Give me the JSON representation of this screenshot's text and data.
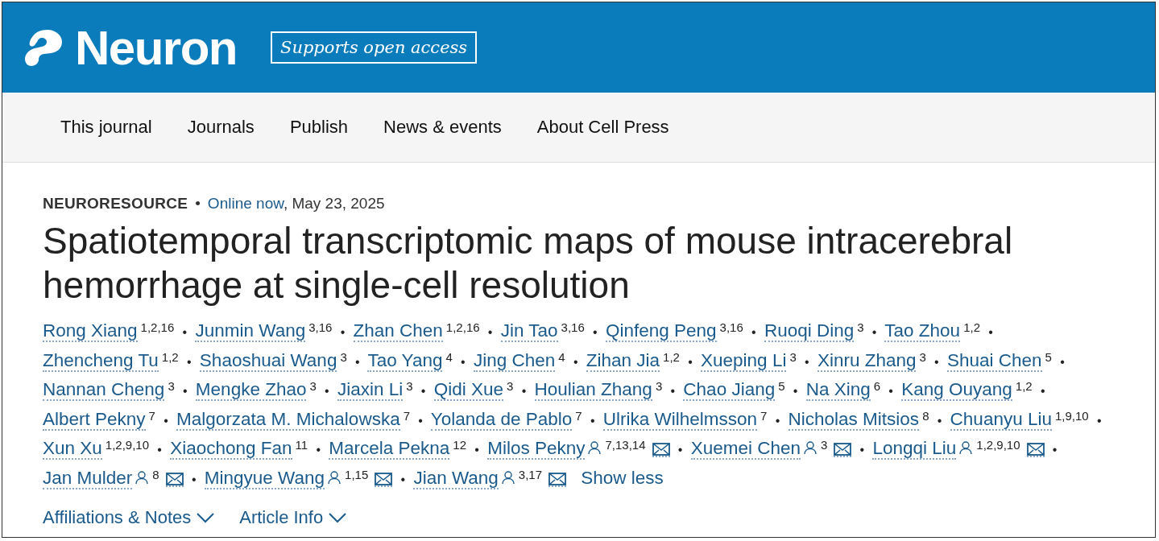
{
  "header": {
    "journal": "Neuron",
    "badge": "Supports open access"
  },
  "nav": {
    "items": [
      "This journal",
      "Journals",
      "Publish",
      "News & events",
      "About Cell Press"
    ]
  },
  "article": {
    "type": "NEURORESOURCE",
    "separator": "•",
    "status": "Online now",
    "date": ", May 23, 2025",
    "title": "Spatiotemporal transcriptomic maps of mouse intracerebral hemorrhage at single-cell resolution",
    "author_separator": "•",
    "authors": [
      {
        "name": "Rong Xiang",
        "affiliations": "1,2,16",
        "corresponding": false
      },
      {
        "name": "Junmin Wang",
        "affiliations": "3,16",
        "corresponding": false
      },
      {
        "name": "Zhan Chen",
        "affiliations": "1,2,16",
        "corresponding": false
      },
      {
        "name": "Jin Tao",
        "affiliations": "3,16",
        "corresponding": false
      },
      {
        "name": "Qinfeng Peng",
        "affiliations": "3,16",
        "corresponding": false
      },
      {
        "name": "Ruoqi Ding",
        "affiliations": "3",
        "corresponding": false
      },
      {
        "name": "Tao Zhou",
        "affiliations": "1,2",
        "corresponding": false
      },
      {
        "name": "Zhencheng Tu",
        "affiliations": "1,2",
        "corresponding": false
      },
      {
        "name": "Shaoshuai Wang",
        "affiliations": "3",
        "corresponding": false
      },
      {
        "name": "Tao Yang",
        "affiliations": "4",
        "corresponding": false
      },
      {
        "name": "Jing Chen",
        "affiliations": "4",
        "corresponding": false
      },
      {
        "name": "Zihan Jia",
        "affiliations": "1,2",
        "corresponding": false
      },
      {
        "name": "Xueping Li",
        "affiliations": "3",
        "corresponding": false
      },
      {
        "name": "Xinru Zhang",
        "affiliations": "3",
        "corresponding": false
      },
      {
        "name": "Shuai Chen",
        "affiliations": "5",
        "corresponding": false
      },
      {
        "name": "Nannan Cheng",
        "affiliations": "3",
        "corresponding": false
      },
      {
        "name": "Mengke Zhao",
        "affiliations": "3",
        "corresponding": false
      },
      {
        "name": "Jiaxin Li",
        "affiliations": "3",
        "corresponding": false
      },
      {
        "name": "Qidi Xue",
        "affiliations": "3",
        "corresponding": false
      },
      {
        "name": "Houlian Zhang",
        "affiliations": "3",
        "corresponding": false
      },
      {
        "name": "Chao Jiang",
        "affiliations": "5",
        "corresponding": false
      },
      {
        "name": "Na Xing",
        "affiliations": "6",
        "corresponding": false
      },
      {
        "name": "Kang Ouyang",
        "affiliations": "1,2",
        "corresponding": false
      },
      {
        "name": "Albert Pekny",
        "affiliations": "7",
        "corresponding": false
      },
      {
        "name": "Malgorzata M. Michalowska",
        "affiliations": "7",
        "corresponding": false
      },
      {
        "name": "Yolanda de Pablo",
        "affiliations": "7",
        "corresponding": false
      },
      {
        "name": "Ulrika Wilhelmsson",
        "affiliations": "7",
        "corresponding": false
      },
      {
        "name": "Nicholas Mitsios",
        "affiliations": "8",
        "corresponding": false
      },
      {
        "name": "Chuanyu Liu",
        "affiliations": "1,9,10",
        "corresponding": false
      },
      {
        "name": "Xun Xu",
        "affiliations": "1,2,9,10",
        "corresponding": false
      },
      {
        "name": "Xiaochong Fan",
        "affiliations": "11",
        "corresponding": false
      },
      {
        "name": "Marcela Pekna",
        "affiliations": "12",
        "corresponding": false
      },
      {
        "name": "Milos Pekny",
        "affiliations": "7,13,14",
        "corresponding": true
      },
      {
        "name": "Xuemei Chen",
        "affiliations": "3",
        "corresponding": true
      },
      {
        "name": "Longqi Liu",
        "affiliations": "1,2,9,10",
        "corresponding": true
      },
      {
        "name": "Jan Mulder",
        "affiliations": "8",
        "corresponding": true
      },
      {
        "name": "Mingyue Wang",
        "affiliations": "1,15",
        "corresponding": true
      },
      {
        "name": "Jian Wang",
        "affiliations": "3,17",
        "corresponding": true
      }
    ],
    "show_less": "Show less",
    "toggles": [
      "Affiliations & Notes",
      "Article Info"
    ]
  }
}
